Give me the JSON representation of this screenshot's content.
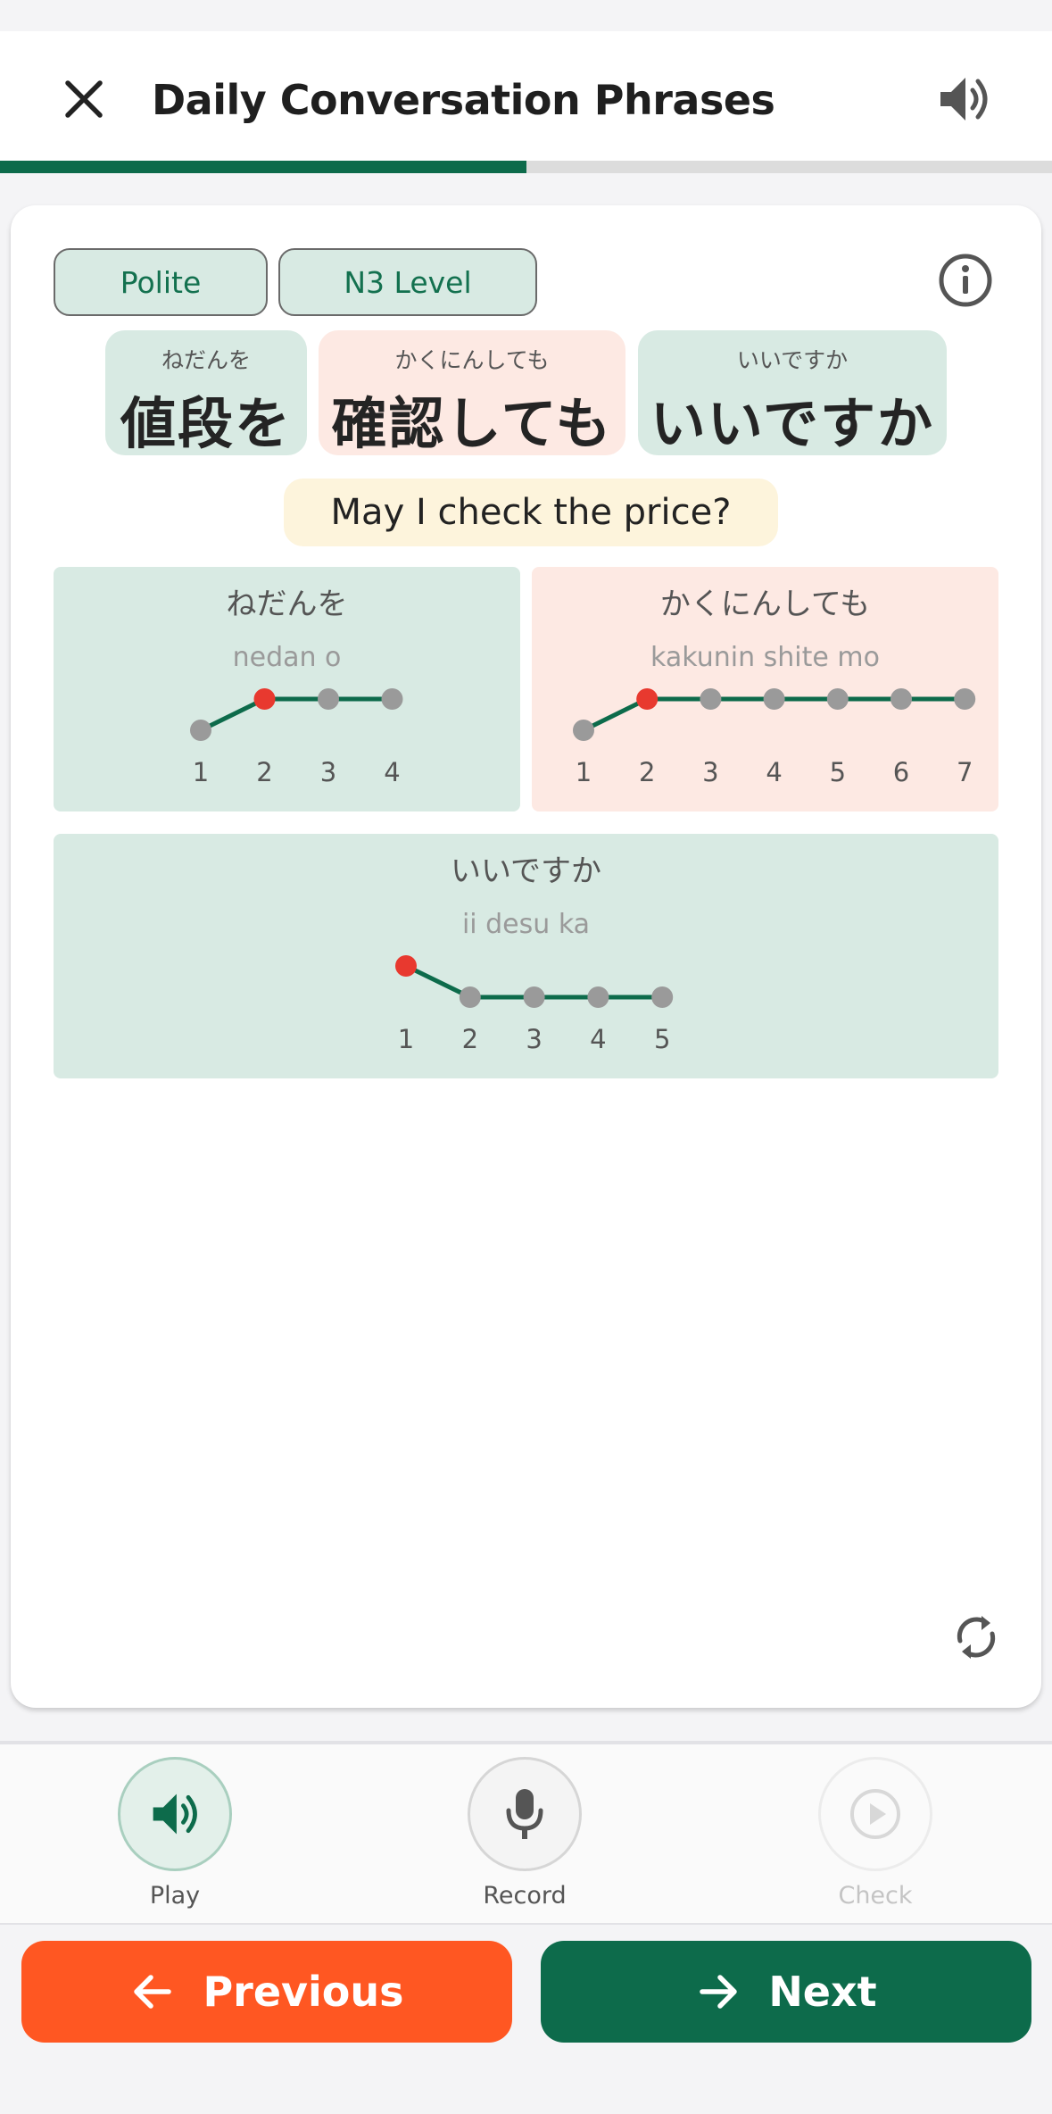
{
  "header": {
    "title": "Daily Conversation Phrases",
    "progress_percent": 50
  },
  "tags": [
    "Polite",
    "N3 Level"
  ],
  "words": [
    {
      "furigana": "ねだんを",
      "text": "値段を",
      "color": "green"
    },
    {
      "furigana": "かくにんしても",
      "text": "確認しても",
      "color": "pink"
    },
    {
      "furigana": "いいですか",
      "text": "いいですか",
      "color": "green"
    }
  ],
  "translation": "May I check the price?",
  "pitch": [
    {
      "kana": "ねだんを",
      "romaji": "nedan o",
      "pattern": [
        "L",
        "H",
        "H",
        "H"
      ],
      "accent_index": 2
    },
    {
      "kana": "かくにんしても",
      "romaji": "kakunin shite mo",
      "pattern": [
        "L",
        "H",
        "H",
        "H",
        "H",
        "H",
        "H"
      ],
      "accent_index": 2
    },
    {
      "kana": "いいですか",
      "romaji": "ii desu ka",
      "pattern": [
        "H",
        "L",
        "L",
        "L",
        "L"
      ],
      "accent_index": 1
    }
  ],
  "actions": {
    "play": "Play",
    "record": "Record",
    "check": "Check"
  },
  "nav": {
    "previous": "Previous",
    "next": "Next"
  },
  "colors": {
    "primary": "#0d6b4b",
    "accent": "#ff5722",
    "green_bg": "#d8eae3",
    "pink_bg": "#fde9e3",
    "highlight": "#fdf4dc"
  }
}
